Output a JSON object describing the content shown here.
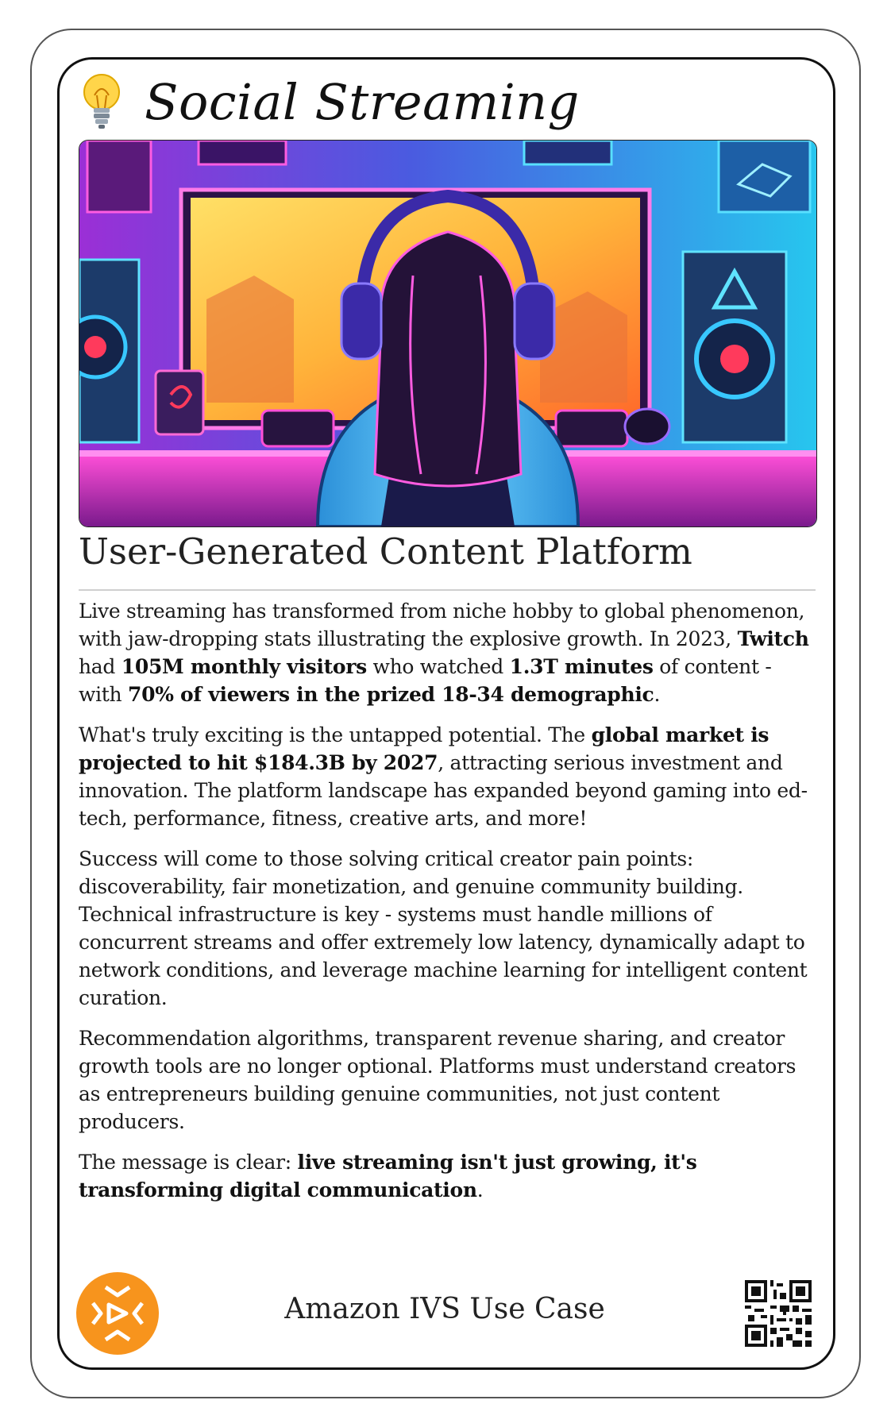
{
  "header": {
    "icon": "lightbulb-icon",
    "title": "Social Streaming"
  },
  "subtitle": "User-Generated Content Platform",
  "paragraphs": [
    {
      "segments": [
        {
          "t": "Live streaming has transformed from niche hobby to global phenomenon, with jaw-dropping stats illustrating the explosive growth. In 2023, "
        },
        {
          "t": "Twitch",
          "b": true
        },
        {
          "t": " had "
        },
        {
          "t": "105M monthly visitors",
          "b": true
        },
        {
          "t": " who watched "
        },
        {
          "t": "1.3T minutes",
          "b": true
        },
        {
          "t": " of content - with "
        },
        {
          "t": "70% of viewers in the prized 18-34 demographic",
          "b": true
        },
        {
          "t": "."
        }
      ]
    },
    {
      "segments": [
        {
          "t": "What's truly exciting is the untapped potential. The "
        },
        {
          "t": "global market is projected to hit $184.3B by 2027",
          "b": true
        },
        {
          "t": ", attracting serious investment and innovation. The platform landscape has expanded beyond gaming into ed-tech, performance, fitness, creative arts, and more!"
        }
      ]
    },
    {
      "segments": [
        {
          "t": "Success will come to those solving critical creator pain points: discoverability, fair monetization, and genuine community building. Technical infrastructure is key - systems must handle millions of concurrent streams and offer extremely low latency, dynamically adapt to network conditions, and leverage machine learning for intelligent content curation."
        }
      ]
    },
    {
      "segments": [
        {
          "t": "Recommendation algorithms, transparent revenue sharing, and creator growth tools are no longer optional. Platforms must understand creators as entrepreneurs building genuine communities, not just content producers."
        }
      ]
    },
    {
      "segments": [
        {
          "t": "The message is clear: "
        },
        {
          "t": "live streaming isn't just growing, it's transforming digital communication",
          "b": true
        },
        {
          "t": "."
        }
      ]
    }
  ],
  "footer": {
    "logo_icon": "amazon-ivs-logo-icon",
    "label": "Amazon IVS Use Case",
    "qr_icon": "qr-code-icon"
  },
  "colors": {
    "brand_orange": "#F7941D",
    "card_border": "#111111"
  }
}
